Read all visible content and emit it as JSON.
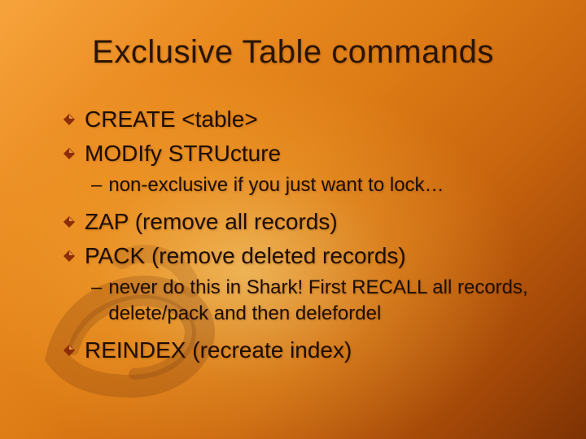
{
  "title": "Exclusive Table commands",
  "bullets": {
    "b1": "CREATE <table>",
    "b2": "MODIfy STRUcture",
    "s1": "non-exclusive if you just want to lock…",
    "b3": "ZAP (remove all records)",
    "b4": "PACK (remove deleted records)",
    "s2": "never do this in Shark! First RECALL all records, delete/pack and then delefordel",
    "b5": "REINDEX (recreate index)"
  },
  "dash": "–",
  "colors": {
    "bullet_fill": "#8b2d06",
    "bullet_hilite": "#ffb347"
  }
}
